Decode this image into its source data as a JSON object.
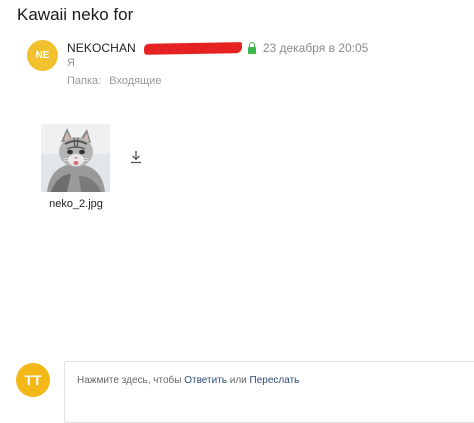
{
  "message": {
    "subject": "Kawaii neko for",
    "sender": {
      "avatar_initials": "NE",
      "avatar_color": "#f2c12e",
      "name": "NEKOCHAN",
      "redaction_color": "#e52121"
    },
    "secure_color": "#3bb44a",
    "date": "23 декабря в 20:05",
    "recipient": "Я",
    "folder_label": "Папка:",
    "folder_name": "Входящие"
  },
  "attachment": {
    "file_name": "neko_2.jpg",
    "thumbnail_icon": "kitten-photo"
  },
  "reply": {
    "avatar_initials": "TT",
    "avatar_color": "#f2b817",
    "prompt_prefix": "Нажмите здесь, чтобы",
    "reply_link": "Ответить",
    "or_text": "или",
    "forward_link": "Переслать"
  }
}
